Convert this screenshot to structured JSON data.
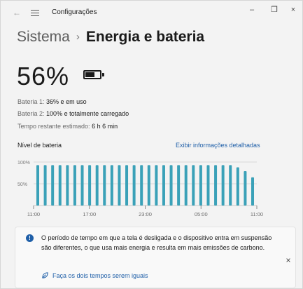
{
  "window": {
    "title": "Configurações",
    "back_icon": "arrow-left-icon",
    "menu_icon": "hamburger-icon",
    "minimize": "–",
    "maximize": "❐",
    "close": "×"
  },
  "breadcrumb": {
    "parent": "Sistema",
    "separator": "›",
    "current": "Energia e bateria"
  },
  "battery": {
    "percent_text": "56%",
    "percent": 56,
    "icon": "battery-icon"
  },
  "details": {
    "b1_label": "Bateria 1:",
    "b1_value": "36% e em uso",
    "b2_label": "Bateria 2:",
    "b2_value": "100% e totalmente carregado",
    "time_label": "Tempo restante estimado:",
    "time_value": "6 h 6 min"
  },
  "chart_section": {
    "title": "Nível de bateria",
    "link": "Exibir informações detalhadas"
  },
  "chart_data": {
    "type": "bar",
    "title": "Nível de bateria",
    "y_ticks": [
      "100%",
      "50%"
    ],
    "ylim": [
      0,
      100
    ],
    "x_tick_labels": [
      "11:00",
      "17:00",
      "23:00",
      "05:00",
      "11:00"
    ],
    "values": [
      93,
      93,
      93,
      93,
      93,
      93,
      93,
      93,
      93,
      93,
      93,
      93,
      93,
      93,
      93,
      93,
      93,
      93,
      93,
      93,
      93,
      93,
      93,
      93,
      93,
      93,
      93,
      88,
      79,
      65
    ],
    "bar_color": "#3aa1b8",
    "grid": true
  },
  "notice": {
    "icon": "info-icon",
    "text": "O período de tempo em que a tela é desligada e o dispositivo entra em suspensão são diferentes, o que usa mais energia e resulta em mais emissões de carbono.",
    "link_icon": "leaf-icon",
    "link": "Faça os dois tempos serem iguais",
    "close": "×"
  }
}
